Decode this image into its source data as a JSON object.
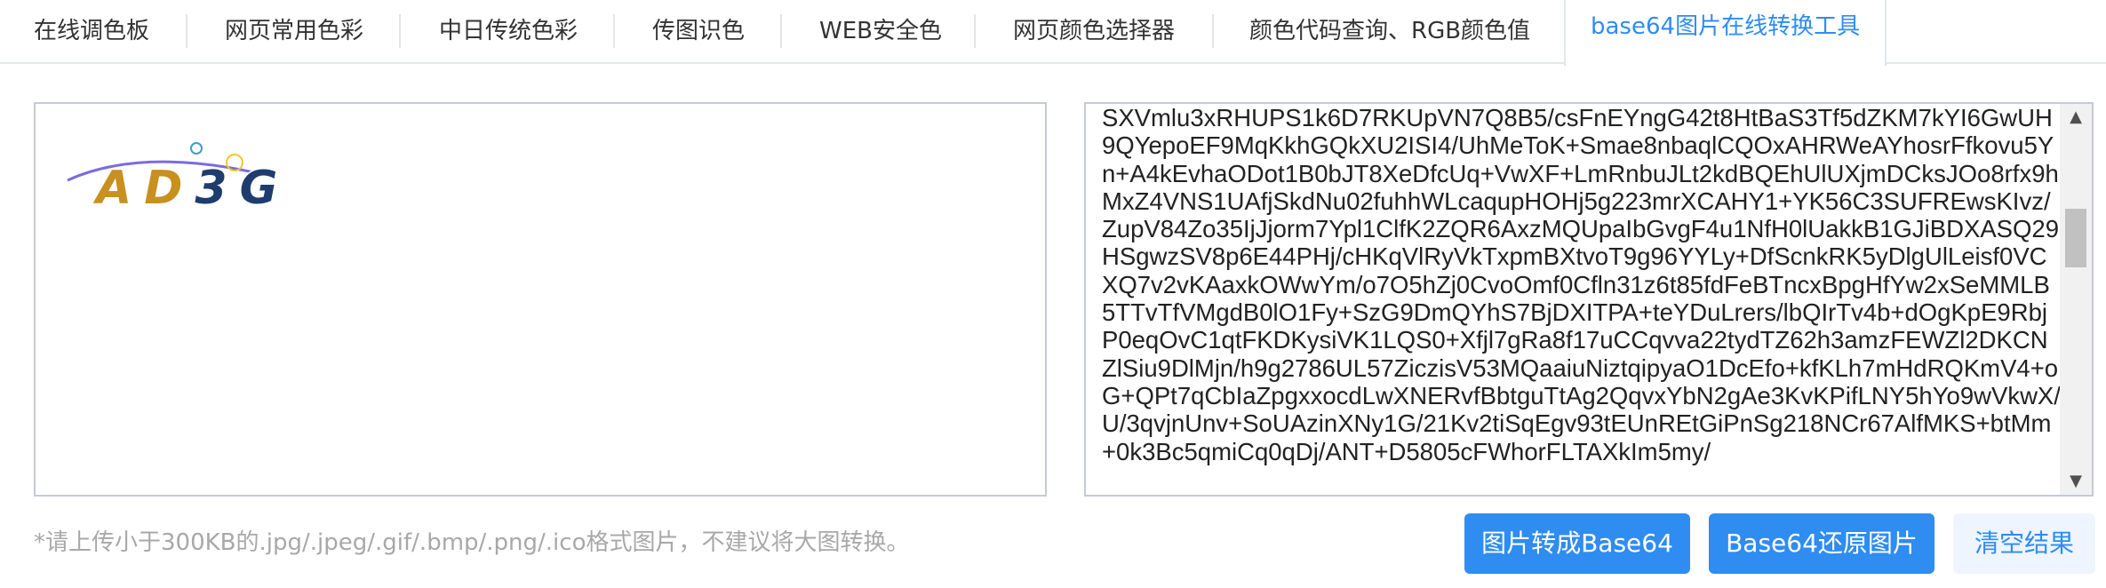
{
  "tabs": [
    {
      "label": "在线调色板"
    },
    {
      "label": "网页常用色彩"
    },
    {
      "label": "中日传统色彩"
    },
    {
      "label": "传图识色"
    },
    {
      "label": "WEB安全色"
    },
    {
      "label": "网页颜色选择器"
    },
    {
      "label": "颜色代码查询、RGB颜色值"
    },
    {
      "label": "base64图片在线转换工具",
      "active": true
    }
  ],
  "preview": {
    "captcha_text": "AD3G",
    "captcha_colors": [
      "#c8901e",
      "#1e3d6e",
      "#7b6be0"
    ]
  },
  "output": {
    "base64_text": "SXVmlu3xRHUPS1k6D7RKUpVN7Q8B5/csFnEYngG42t8HtBaS3Tf5dZKM7kYI6GwUH9QYepoEF9MqKkhGQkXU2ISI4/UhMeToK+Smae8nbaqlCQOxAHRWeAYhosrFfkovu5Yn+A4kEvhaODot1B0bJT8XeDfcUq+VwXF+LmRnbuJLt2kdBQEhUlUXjmDCksJOo8rfx9hMxZ4VNS1UAfjSkdNu02fuhhWLcaqupHOHj5g223mrXCAHY1+YK56C3SUFREwsKIvz/ZupV84Zo35IjJjorm7Ypl1ClfK2ZQR6AxzMQUpaIbGvgF4u1NfH0lUakkB1GJiBDXASQ29HSgwzSV8p6E44PHj/cHKqVlRyVkTxpmBXtvoT9g96YYLy+DfScnkRK5yDlgUlLeisf0VCXQ7v2vKAaxkOWwYm/o7O5hZj0CvoOmf0Cfln31z6t85fdFeBTncxBpgHfYw2xSeMMLB5TTvTfVMgdB0lO1Fy+SzG9DmQYhS7BjDXITPA+teYDuLrers/lbQIrTv4b+dOgKpE9RbjP0eqOvC1qtFKDKysiVK1LQS0+Xfjl7gRa8f17uCCqvva22tydTZ62h3amzFEWZl2DKCNZlSiu9DlMjn/h9g2786UL57ZiczisV53MQaaiuNiztqipyaO1DcEfo+kfKLh7mHdRQKmV4+oG+QPt7qCbIaZpgxxocdLwXNERvfBbtguTtAg2QqvxYbN2gAe3KvKPifLNY5hYo9wVkwX/U/3qvjnUnv+SoUAzinXNy1G/21Kv2tiSqEgv93tEUnREtGiPnSg218NCr67AlfMKS+btMm+0k3Bc5qmiCq0qDj/ANT+D5805cFWhorFLTAXkIm5my/"
  },
  "hint": "*请上传小于300KB的.jpg/.jpeg/.gif/.bmp/.png/.ico格式图片，不建议将大图转换。",
  "buttons": {
    "to_base64": "图片转成Base64",
    "restore": "Base64还原图片",
    "clear": "清空结果"
  }
}
